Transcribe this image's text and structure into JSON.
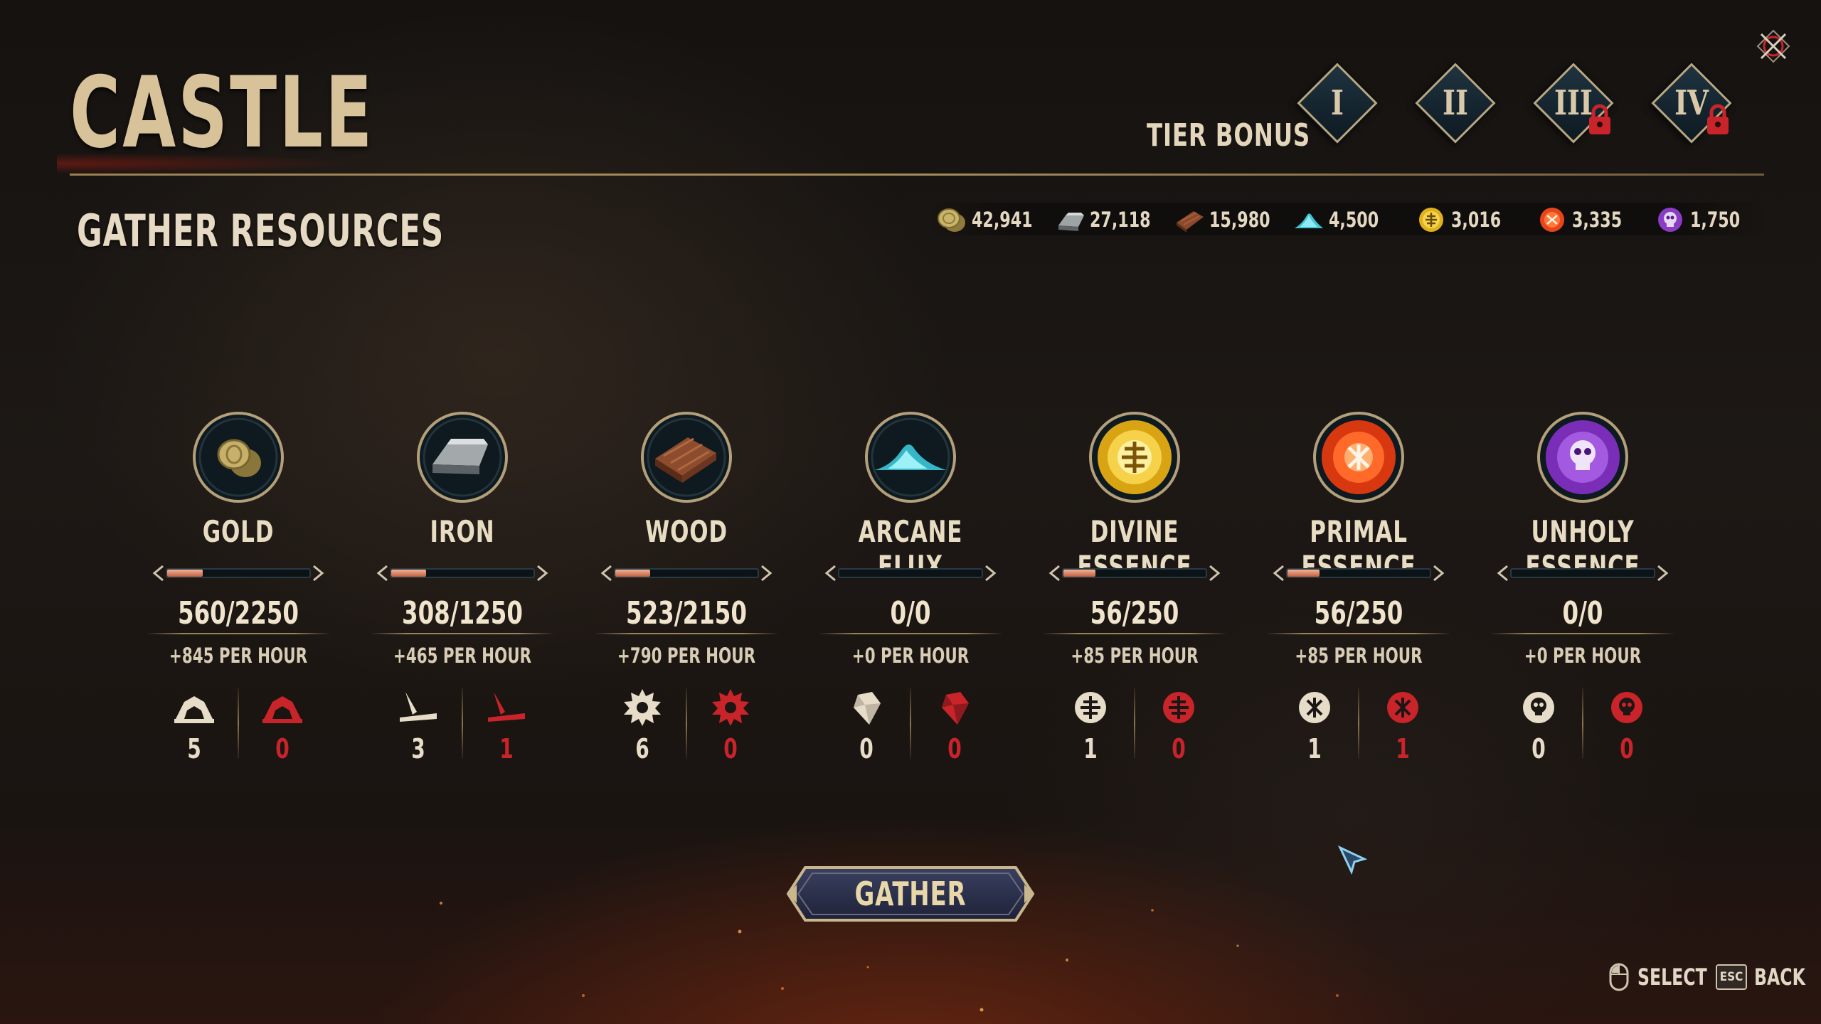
{
  "header": {
    "title": "CASTLE",
    "tier_bonus_label": "TIER BONUS",
    "tiers": [
      {
        "numeral": "I",
        "locked": false
      },
      {
        "numeral": "II",
        "locked": false
      },
      {
        "numeral": "III",
        "locked": true
      },
      {
        "numeral": "IV",
        "locked": true
      }
    ],
    "close_icon": "close-x-icon"
  },
  "section": {
    "title": "GATHER RESOURCES"
  },
  "currencies": [
    {
      "name": "gold",
      "icon": "gold-coins-icon",
      "value": "42,941"
    },
    {
      "name": "iron",
      "icon": "iron-ingot-icon",
      "value": "27,118"
    },
    {
      "name": "wood",
      "icon": "wood-planks-icon",
      "value": "15,980"
    },
    {
      "name": "arcane-flux",
      "icon": "arcane-flux-icon",
      "value": "4,500"
    },
    {
      "name": "divine-essence",
      "icon": "divine-essence-icon",
      "value": "3,016"
    },
    {
      "name": "primal-essence",
      "icon": "primal-essence-icon",
      "value": "3,335"
    },
    {
      "name": "unholy-essence",
      "icon": "unholy-essence-icon",
      "value": "1,750"
    }
  ],
  "resources": [
    {
      "name": "GOLD",
      "amount": "560/2250",
      "fill": 0.249,
      "rate": "+845 PER HOUR",
      "workers": "5",
      "disabled": "0",
      "icon": "gold-coins-icon"
    },
    {
      "name": "IRON",
      "amount": "308/1250",
      "fill": 0.246,
      "rate": "+465 PER HOUR",
      "workers": "3",
      "disabled": "1",
      "icon": "iron-ingot-icon"
    },
    {
      "name": "WOOD",
      "amount": "523/2150",
      "fill": 0.243,
      "rate": "+790 PER HOUR",
      "workers": "6",
      "disabled": "0",
      "icon": "wood-planks-icon"
    },
    {
      "name": "ARCANE FLUX",
      "amount": "0/0",
      "fill": 0,
      "rate": "+0 PER HOUR",
      "workers": "0",
      "disabled": "0",
      "icon": "arcane-flux-icon"
    },
    {
      "name": "DIVINE ESSENCE",
      "amount": "56/250",
      "fill": 0.224,
      "rate": "+85 PER HOUR",
      "workers": "1",
      "disabled": "0",
      "icon": "divine-essence-icon"
    },
    {
      "name": "PRIMAL ESSENCE",
      "amount": "56/250",
      "fill": 0.224,
      "rate": "+85 PER HOUR",
      "workers": "1",
      "disabled": "1",
      "icon": "primal-essence-icon"
    },
    {
      "name": "UNHOLY ESSENCE",
      "amount": "0/0",
      "fill": 0,
      "rate": "+0 PER HOUR",
      "workers": "0",
      "disabled": "0",
      "icon": "unholy-essence-icon"
    }
  ],
  "actions": {
    "gather_label": "GATHER"
  },
  "hints": {
    "select_label": "SELECT",
    "back_label": "BACK",
    "esc_key": "ESC"
  },
  "colors": {
    "accent_gold": "#d8c29a",
    "bar_fill": "#e08a6a",
    "disabled_red": "#c8242a",
    "panel_dark": "#0d1a22"
  }
}
